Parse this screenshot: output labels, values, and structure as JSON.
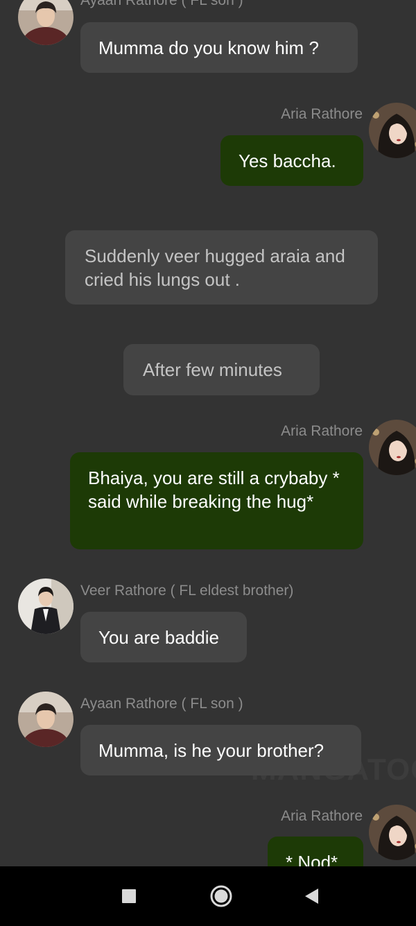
{
  "messages": [
    {
      "type": "received",
      "sender": "Ayaan Rathore ( FL son )",
      "text": "Mumma do you know him ?",
      "avatar": "ayaan-avatar"
    },
    {
      "type": "sent",
      "sender": "Aria Rathore",
      "text": "Yes baccha.",
      "avatar": "aria-avatar"
    },
    {
      "type": "narration",
      "text": "Suddenly veer hugged araia and cried his lungs out ."
    },
    {
      "type": "narration",
      "text": "After few minutes"
    },
    {
      "type": "sent",
      "sender": "Aria Rathore",
      "text": "Bhaiya, you are still a crybaby * said while breaking the hug*",
      "avatar": "aria-avatar"
    },
    {
      "type": "received",
      "sender": "Veer Rathore ( FL eldest brother)",
      "text": "You are baddie",
      "avatar": "veer-avatar"
    },
    {
      "type": "received",
      "sender": "Ayaan Rathore ( FL son )",
      "text": "Mumma, is he your brother?",
      "avatar": "ayaan-avatar"
    },
    {
      "type": "sent",
      "sender": "Aria Rathore",
      "text": "* Nod*",
      "avatar": "aria-avatar"
    }
  ],
  "watermark": "MANGATOON",
  "navbar": {
    "icons": [
      "recents-square-icon",
      "home-circle-icon",
      "back-triangle-icon"
    ]
  },
  "colors": {
    "background": "#333333",
    "received_bubble": "#444444",
    "sent_bubble": "#1d3a06",
    "name_text": "#8c8c8c",
    "narration_text": "#c4c4c4",
    "navbar": "#000000"
  }
}
